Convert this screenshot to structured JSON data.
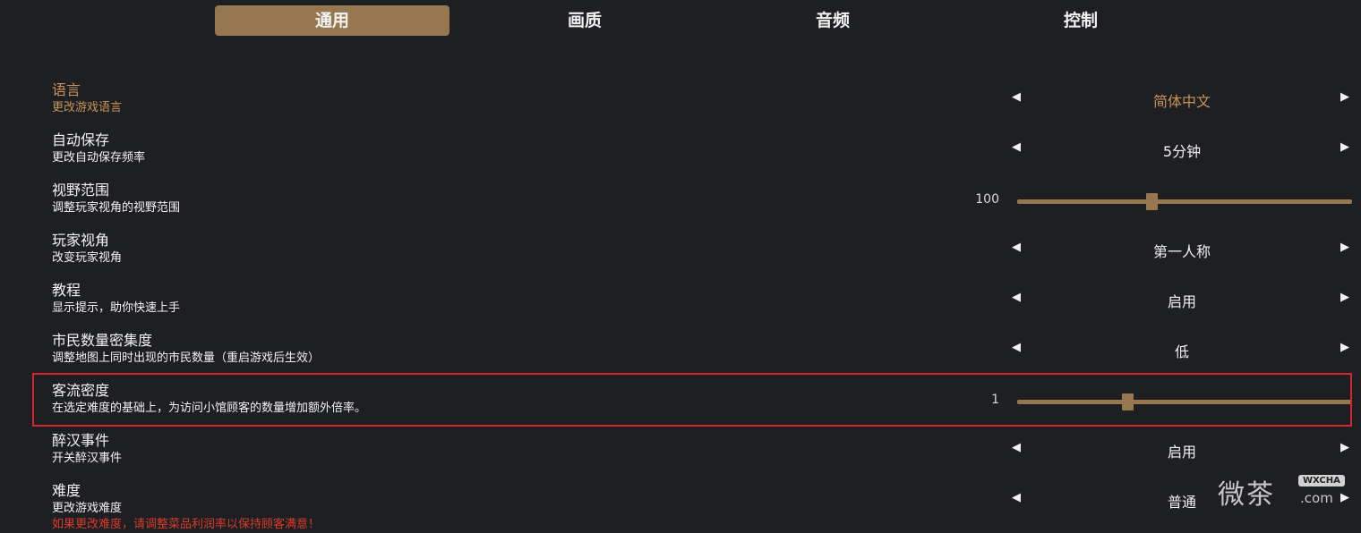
{
  "tabs": [
    "通用",
    "画质",
    "音频",
    "控制"
  ],
  "active_tab": "通用",
  "settings": {
    "language": {
      "title": "语言",
      "desc": "更改游戏语言",
      "value": "简体中文"
    },
    "autosave": {
      "title": "自动保存",
      "desc": "更改自动保存频率",
      "value": "5分钟"
    },
    "fov": {
      "title": "视野范围",
      "desc": "调整玩家视角的视野范围",
      "value": "100",
      "level": 0.4
    },
    "perspective": {
      "title": "玩家视角",
      "desc": "改变玩家视角",
      "value": "第一人称"
    },
    "tutorial": {
      "title": "教程",
      "desc": "显示提示，助你快速上手",
      "value": "启用"
    },
    "citizen_density": {
      "title": "市民数量密集度",
      "desc": "调整地图上同时出现的市民数量（重启游戏后生效）",
      "value": "低"
    },
    "guest_density": {
      "title": "客流密度",
      "desc": "在选定难度的基础上，为访问小馆顾客的数量增加额外倍率。",
      "value": "1",
      "level": 0.33
    },
    "drunk_event": {
      "title": "醉汉事件",
      "desc": "开关醉汉事件",
      "value": "启用"
    },
    "difficulty": {
      "title": "难度",
      "desc": "更改游戏难度",
      "value": "普通",
      "warning": "如果更改难度，请调整菜品利润率以保持顾客满意！"
    }
  },
  "watermark": {
    "text": "微茶",
    "badge": "WXCHA",
    "domain": ".com"
  },
  "colors": {
    "accent": "#97774f",
    "highlight_text": "#c8935a",
    "background": "#1e1f22",
    "red_outline": "#d3252f",
    "warning": "#d93b2b"
  }
}
